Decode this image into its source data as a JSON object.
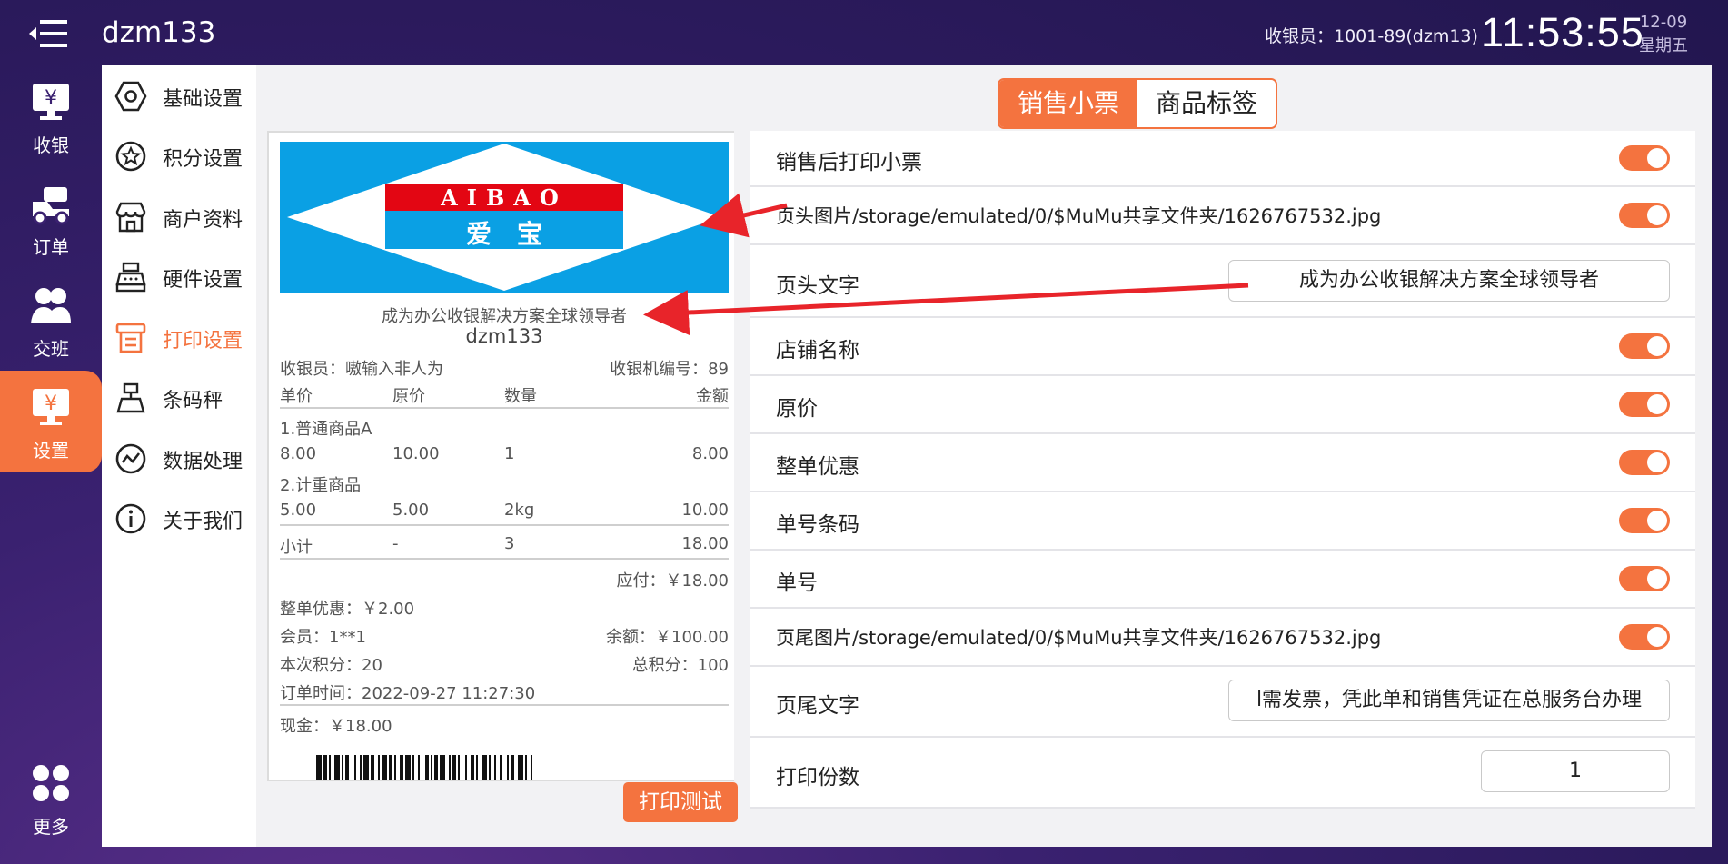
{
  "topbar": {
    "store_name": "dzm133",
    "cashier": "收银员：1001-89(dzm13)",
    "time": "11:53:55",
    "date": "12-09",
    "weekday": "星期五"
  },
  "nav": {
    "items": [
      {
        "label": "收银",
        "icon": "cash-register-icon"
      },
      {
        "label": "订单",
        "icon": "orders-icon"
      },
      {
        "label": "交班",
        "icon": "shift-handover-icon"
      },
      {
        "label": "设置",
        "icon": "settings-icon"
      },
      {
        "label": "更多",
        "icon": "more-grid-icon"
      }
    ],
    "active": "设置"
  },
  "subnav": {
    "items": [
      {
        "label": "基础设置",
        "icon": "hexagon-icon"
      },
      {
        "label": "积分设置",
        "icon": "star-badge-icon"
      },
      {
        "label": "商户资料",
        "icon": "store-icon"
      },
      {
        "label": "硬件设置",
        "icon": "cash-machine-icon"
      },
      {
        "label": "打印设置",
        "icon": "printer-icon"
      },
      {
        "label": "条码秤",
        "icon": "scale-icon"
      },
      {
        "label": "数据处理",
        "icon": "chart-icon"
      },
      {
        "label": "关于我们",
        "icon": "info-icon"
      }
    ],
    "active": "打印设置"
  },
  "tabs": {
    "items": [
      "销售小票",
      "商品标签"
    ],
    "active": "销售小票"
  },
  "receipt": {
    "logo_text_top": "AIBAO",
    "logo_text_bottom": "爱　宝",
    "header_text": "成为办公收银解决方案全球领导者",
    "store_name": "dzm133",
    "cashier": "收银员：嗷输入非人为",
    "machine_no": "收银机编号：89",
    "columns": [
      "单价",
      "原价",
      "数量",
      "金额"
    ],
    "items": [
      {
        "name": "1.普通商品A",
        "price": "8.00",
        "orig": "10.00",
        "qty": "1",
        "amount": "8.00"
      },
      {
        "name": "2.计重商品",
        "price": "5.00",
        "orig": "5.00",
        "qty": "2kg",
        "amount": "10.00"
      }
    ],
    "subtotal": {
      "label": "小计",
      "orig": "-",
      "qty": "3",
      "amount": "18.00"
    },
    "payable": "应付：￥18.00",
    "discount": "整单优惠：￥2.00",
    "member": "会员：1**1",
    "balance": "余额：￥100.00",
    "points_this": "本次积分：20",
    "points_total": "总积分：100",
    "order_time": "订单时间：2022-09-27 11:27:30",
    "cash": "现金：￥18.00"
  },
  "print_test_label": "打印测试",
  "settings": {
    "print_after_sale": {
      "label": "销售后打印小票",
      "on": true
    },
    "header_image": {
      "label": "页头图片/storage/emulated/0/$MuMu共享文件夹/1626767532.jpg",
      "on": true
    },
    "header_text": {
      "label": "页头文字",
      "value": "成为办公收银解决方案全球领导者"
    },
    "store_name": {
      "label": "店铺名称",
      "on": true
    },
    "original_price": {
      "label": "原价",
      "on": true
    },
    "order_discount": {
      "label": "整单优惠",
      "on": true
    },
    "order_barcode": {
      "label": "单号条码",
      "on": true
    },
    "order_no": {
      "label": "单号",
      "on": true
    },
    "footer_image": {
      "label": "页尾图片/storage/emulated/0/$MuMu共享文件夹/1626767532.jpg",
      "on": true
    },
    "footer_text": {
      "label": "页尾文字",
      "value": "l需发票，凭此单和销售凭证在总服务台办理"
    },
    "copies": {
      "label": "打印份数",
      "value": "1"
    }
  },
  "colors": {
    "accent": "#f4733f",
    "background": "#2b1a5c",
    "logo_blue": "#0aa0e4",
    "logo_red": "#e30613"
  }
}
